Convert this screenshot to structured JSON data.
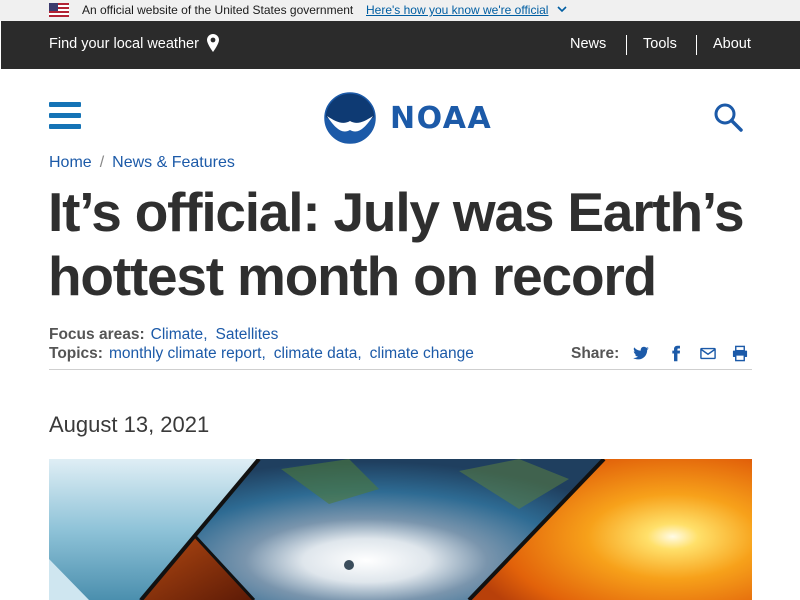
{
  "gov_banner": {
    "text": "An official website of the United States government",
    "link": "Here's how you know we're official"
  },
  "topnav": {
    "weather": "Find your local weather",
    "items": [
      "News",
      "Tools",
      "About"
    ]
  },
  "header": {
    "logo_text": "NOAA"
  },
  "breadcrumb": [
    "Home",
    "News & Features"
  ],
  "article": {
    "title": "It’s official: July was Earth’s hottest month on record",
    "focus_label": "Focus areas:",
    "focus_areas": [
      "Climate",
      "Satellites"
    ],
    "topics_label": "Topics:",
    "topics": [
      "monthly climate report",
      "climate data",
      "climate change"
    ],
    "share_label": "Share:",
    "date": "August 13, 2021"
  },
  "icons": {
    "flag": "us-flag-icon",
    "chevron": "chevron-down-icon",
    "pin": "location-pin-icon",
    "menu": "hamburger-menu-icon",
    "search": "search-icon",
    "share": [
      "twitter-icon",
      "facebook-icon",
      "email-icon",
      "print-icon"
    ]
  },
  "colors": {
    "brand_blue": "#1c5aa8",
    "nav_bg": "#2b2b2b",
    "banner_bg": "#f0f0f0",
    "link": "#005ea2"
  }
}
